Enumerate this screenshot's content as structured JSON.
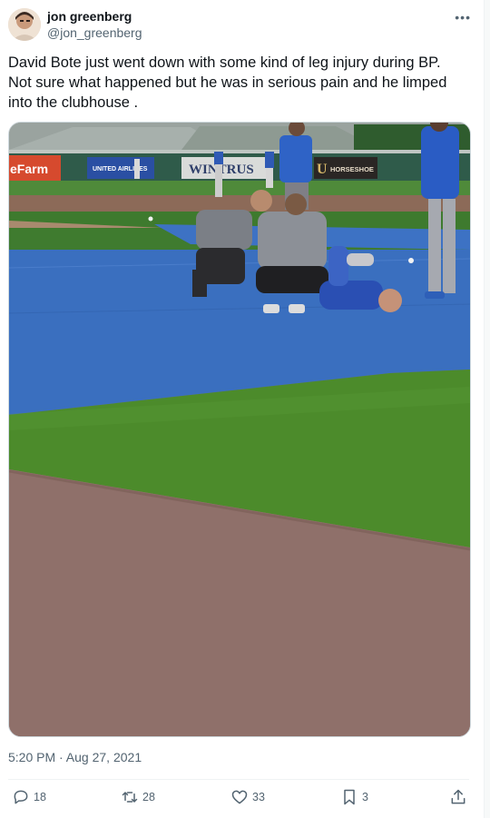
{
  "author": {
    "name": "jon greenberg",
    "handle": "@jon_greenberg"
  },
  "tweet": {
    "text": "David Bote just went down with some kind of leg injury during BP. Not sure what happened but he was in serious pain and he limped into the clubhouse .",
    "timestamp": "5:20 PM · Aug 27, 2021"
  },
  "media": {
    "description_icons": [
      "photo"
    ],
    "signs": {
      "farm": "eFarm",
      "united": "UNITED AIRLINES",
      "wintrust": "WINTRUS",
      "horseshoe": "HORSESHOE"
    }
  },
  "actions": {
    "replies": "18",
    "retweets": "28",
    "likes": "33",
    "bookmarks": "3"
  },
  "colors": {
    "tarp": "#3a6fbf",
    "grass": "#4a8a2c",
    "dirt": "#8f706a",
    "text_secondary": "#536471"
  },
  "icons": {
    "more": "more-icon",
    "reply": "reply-icon",
    "retweet": "retweet-icon",
    "like": "like-icon",
    "bookmark": "bookmark-icon",
    "share": "share-icon"
  }
}
